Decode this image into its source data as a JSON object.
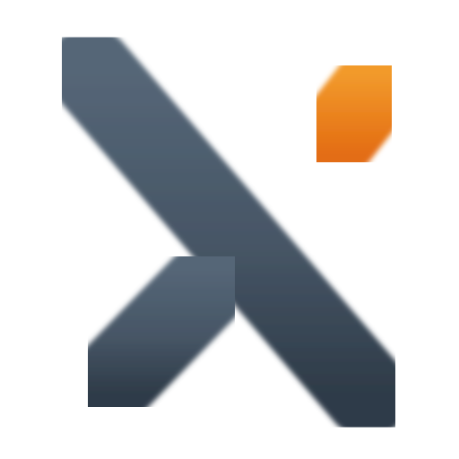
{
  "logo": {
    "icon": "x-logo-icon",
    "colors": {
      "slate_top": "#556677",
      "slate_mid": "#465565",
      "slate_bottom": "#2e3b48",
      "orange_top": "#f29a2c",
      "orange_bottom": "#e36d12",
      "background": "#ffffff"
    }
  }
}
